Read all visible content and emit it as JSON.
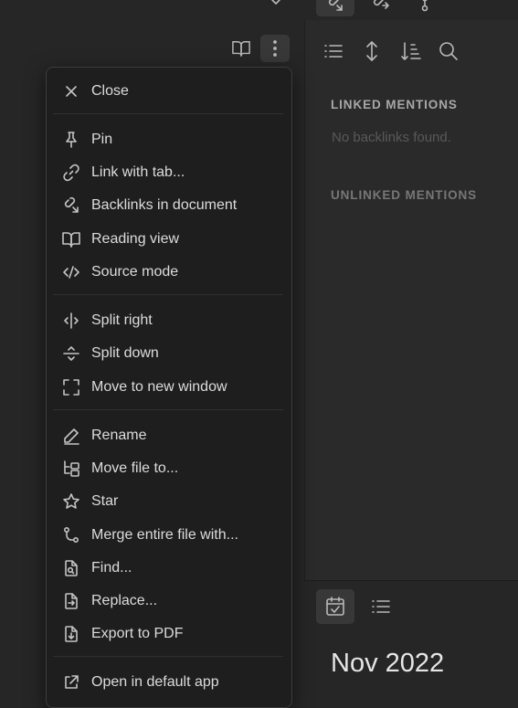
{
  "right_sidebar": {
    "linked_mentions_label": "LINKED MENTIONS",
    "no_backlinks_text": "No backlinks found.",
    "unlinked_mentions_label": "UNLINKED MENTIONS"
  },
  "calendar": {
    "month_label": "Nov 2022"
  },
  "context_menu": {
    "items": [
      {
        "label": "Close",
        "icon": "close-icon"
      },
      {
        "label": "Pin",
        "icon": "pin-icon"
      },
      {
        "label": "Link with tab...",
        "icon": "link-icon"
      },
      {
        "label": "Backlinks in document",
        "icon": "backlinks-icon"
      },
      {
        "label": "Reading view",
        "icon": "book-open-icon"
      },
      {
        "label": "Source mode",
        "icon": "code-icon"
      },
      {
        "label": "Split right",
        "icon": "split-right-icon"
      },
      {
        "label": "Split down",
        "icon": "split-down-icon"
      },
      {
        "label": "Move to new window",
        "icon": "maximize-icon"
      },
      {
        "label": "Rename",
        "icon": "pencil-icon"
      },
      {
        "label": "Move file to...",
        "icon": "folder-tree-icon"
      },
      {
        "label": "Star",
        "icon": "star-icon"
      },
      {
        "label": "Merge entire file with...",
        "icon": "git-merge-icon"
      },
      {
        "label": "Find...",
        "icon": "file-search-icon"
      },
      {
        "label": "Replace...",
        "icon": "file-replace-icon"
      },
      {
        "label": "Export to PDF",
        "icon": "file-export-icon"
      },
      {
        "label": "Open in default app",
        "icon": "external-link-icon"
      }
    ]
  }
}
